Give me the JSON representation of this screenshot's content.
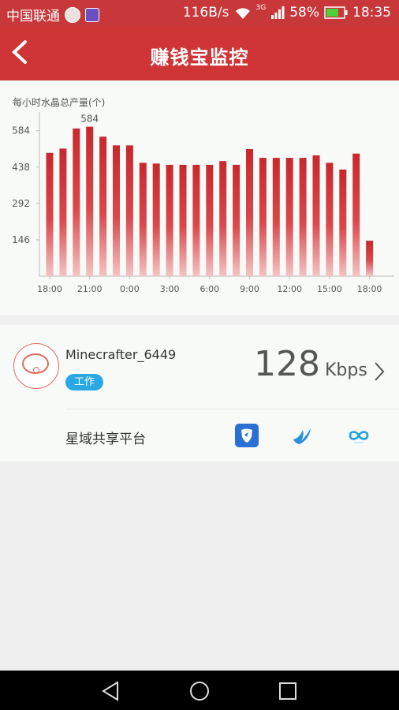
{
  "status_bar": {
    "carrier": "中国联通",
    "network_speed": "116B/s",
    "network_type": "3G",
    "battery": "58%",
    "time": "18:35"
  },
  "header": {
    "title": "赚钱宝监控",
    "back_icon": "back-arrow-icon"
  },
  "chart_data": {
    "type": "bar",
    "ylabel": "每小时水晶总产量(个)",
    "yticks": [
      146,
      292,
      438,
      584
    ],
    "ylim": [
      0,
      640
    ],
    "xticks": [
      "18:00",
      "21:00",
      "0:00",
      "3:00",
      "6:00",
      "9:00",
      "12:00",
      "15:00",
      "18:00"
    ],
    "values": [
      495,
      512,
      593,
      600,
      560,
      525,
      525,
      455,
      452,
      447,
      447,
      447,
      447,
      462,
      447,
      510,
      475,
      475,
      475,
      475,
      485,
      455,
      428,
      492,
      142
    ],
    "max_label": "584",
    "bar_color": "#c8282c"
  },
  "device": {
    "name": "Minecrafter_6449",
    "status": "工作",
    "speed_value": "128",
    "speed_unit": "Kbps"
  },
  "platform": {
    "label": "星域共享平台",
    "icons": [
      "shield-icon",
      "swallow-icon",
      "infinity-icon"
    ]
  },
  "nav": {
    "icons": [
      "back-triangle-icon",
      "home-circle-icon",
      "recents-square-icon"
    ]
  }
}
